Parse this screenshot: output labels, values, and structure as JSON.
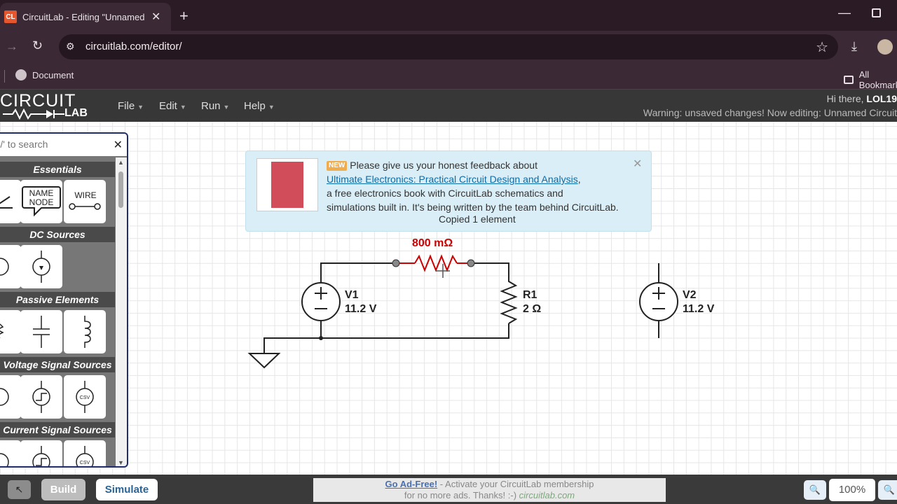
{
  "browser": {
    "tab_title": "CircuitLab - Editing \"Unnamed Circuit\"",
    "favicon": "CL",
    "url": "circuitlab.com/editor/",
    "bookmark_1": "Document",
    "bookmarks_all": "All Bookmarks"
  },
  "app": {
    "logo_top": "CIRCUIT",
    "logo_bottom": "LAB",
    "menus": [
      "File",
      "Edit",
      "Run",
      "Help"
    ],
    "greeting_prefix": "Hi there, ",
    "username": "LOL19",
    "warning": "Warning: unsaved changes! Now editing: Unnamed Circuit"
  },
  "panel": {
    "search_placeholder": "Press '/' to search",
    "categories": [
      "Essentials",
      "DC Sources",
      "Passive Elements",
      "Voltage Signal Sources",
      "Current Signal Sources"
    ],
    "name_node": "NAME NODE",
    "wire": "WIRE"
  },
  "banner": {
    "badge": "NEW",
    "line1": "Please give us your honest feedback about",
    "link": "Ultimate Electronics: Practical Circuit Design and Analysis",
    "line1_end": ",",
    "line2": "a free electronics book with CircuitLab schematics and",
    "line3": "simulations built in. It's being written by the team behind CircuitLab.",
    "copied": "Copied 1 element"
  },
  "schematic": {
    "r2_value": "800 mΩ",
    "v1_name": "V1",
    "v1_value": "11.2 V",
    "r1_name": "R1",
    "r1_value": "2 Ω",
    "v2_name": "V2",
    "v2_value": "11.2 V"
  },
  "toolbar": {
    "build": "Build",
    "simulate": "Simulate",
    "ad_link": "Go Ad-Free!",
    "ad_text": " - Activate your CircuitLab membership",
    "ad_line2": "for no more ads. Thanks! :-) ",
    "ad_domain": "circuitlab.com",
    "zoom": "100%"
  },
  "colors": {
    "selected_part": "#c00000",
    "header_bg": "#373737",
    "banner_bg": "#d9eef6"
  }
}
